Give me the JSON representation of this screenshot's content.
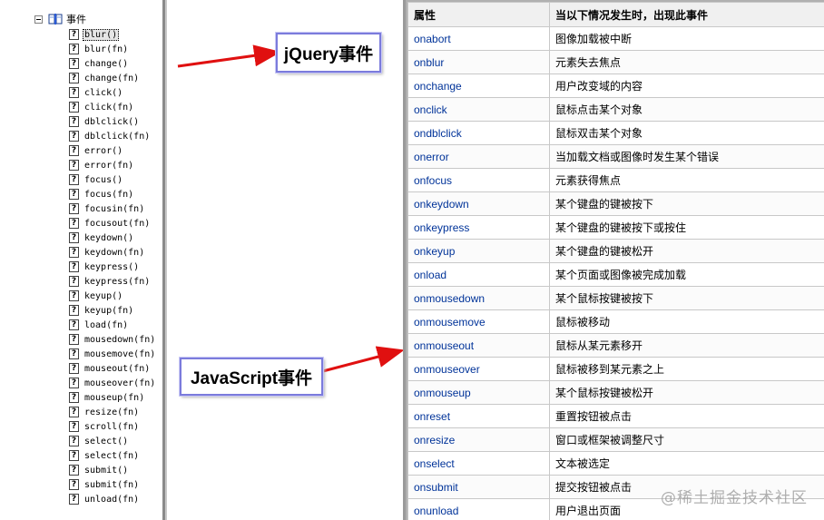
{
  "tree": {
    "root_label": "事件",
    "items": [
      "blur()",
      "blur(fn)",
      "change()",
      "change(fn)",
      "click()",
      "click(fn)",
      "dblclick()",
      "dblclick(fn)",
      "error()",
      "error(fn)",
      "focus()",
      "focus(fn)",
      "focusin(fn)",
      "focusout(fn)",
      "keydown()",
      "keydown(fn)",
      "keypress()",
      "keypress(fn)",
      "keyup()",
      "keyup(fn)",
      "load(fn)",
      "mousedown(fn)",
      "mousemove(fn)",
      "mouseout(fn)",
      "mouseover(fn)",
      "mouseup(fn)",
      "resize(fn)",
      "scroll(fn)",
      "select()",
      "select(fn)",
      "submit()",
      "submit(fn)",
      "unload(fn)"
    ],
    "selected_index": 0,
    "help_icon_glyph": "?"
  },
  "callouts": {
    "jquery": "jQuery事件",
    "javascript": "JavaScript事件"
  },
  "table": {
    "headers": [
      "属性",
      "当以下情况发生时，出现此事件"
    ],
    "rows": [
      [
        "onabort",
        "图像加载被中断"
      ],
      [
        "onblur",
        "元素失去焦点"
      ],
      [
        "onchange",
        "用户改变域的内容"
      ],
      [
        "onclick",
        "鼠标点击某个对象"
      ],
      [
        "ondblclick",
        "鼠标双击某个对象"
      ],
      [
        "onerror",
        "当加载文档或图像时发生某个错误"
      ],
      [
        "onfocus",
        "元素获得焦点"
      ],
      [
        "onkeydown",
        "某个键盘的键被按下"
      ],
      [
        "onkeypress",
        "某个键盘的键被按下或按住"
      ],
      [
        "onkeyup",
        "某个键盘的键被松开"
      ],
      [
        "onload",
        "某个页面或图像被完成加载"
      ],
      [
        "onmousedown",
        "某个鼠标按键被按下"
      ],
      [
        "onmousemove",
        "鼠标被移动"
      ],
      [
        "onmouseout",
        "鼠标从某元素移开"
      ],
      [
        "onmouseover",
        "鼠标被移到某元素之上"
      ],
      [
        "onmouseup",
        "某个鼠标按键被松开"
      ],
      [
        "onreset",
        "重置按钮被点击"
      ],
      [
        "onresize",
        "窗口或框架被调整尺寸"
      ],
      [
        "onselect",
        "文本被选定"
      ],
      [
        "onsubmit",
        "提交按钮被点击"
      ],
      [
        "onunload",
        "用户退出页面"
      ]
    ]
  },
  "watermark": "@稀土掘金技术社区",
  "colors": {
    "arrow": "#e01010",
    "callout_border": "#7b7bdc",
    "attr_text": "#003399"
  }
}
